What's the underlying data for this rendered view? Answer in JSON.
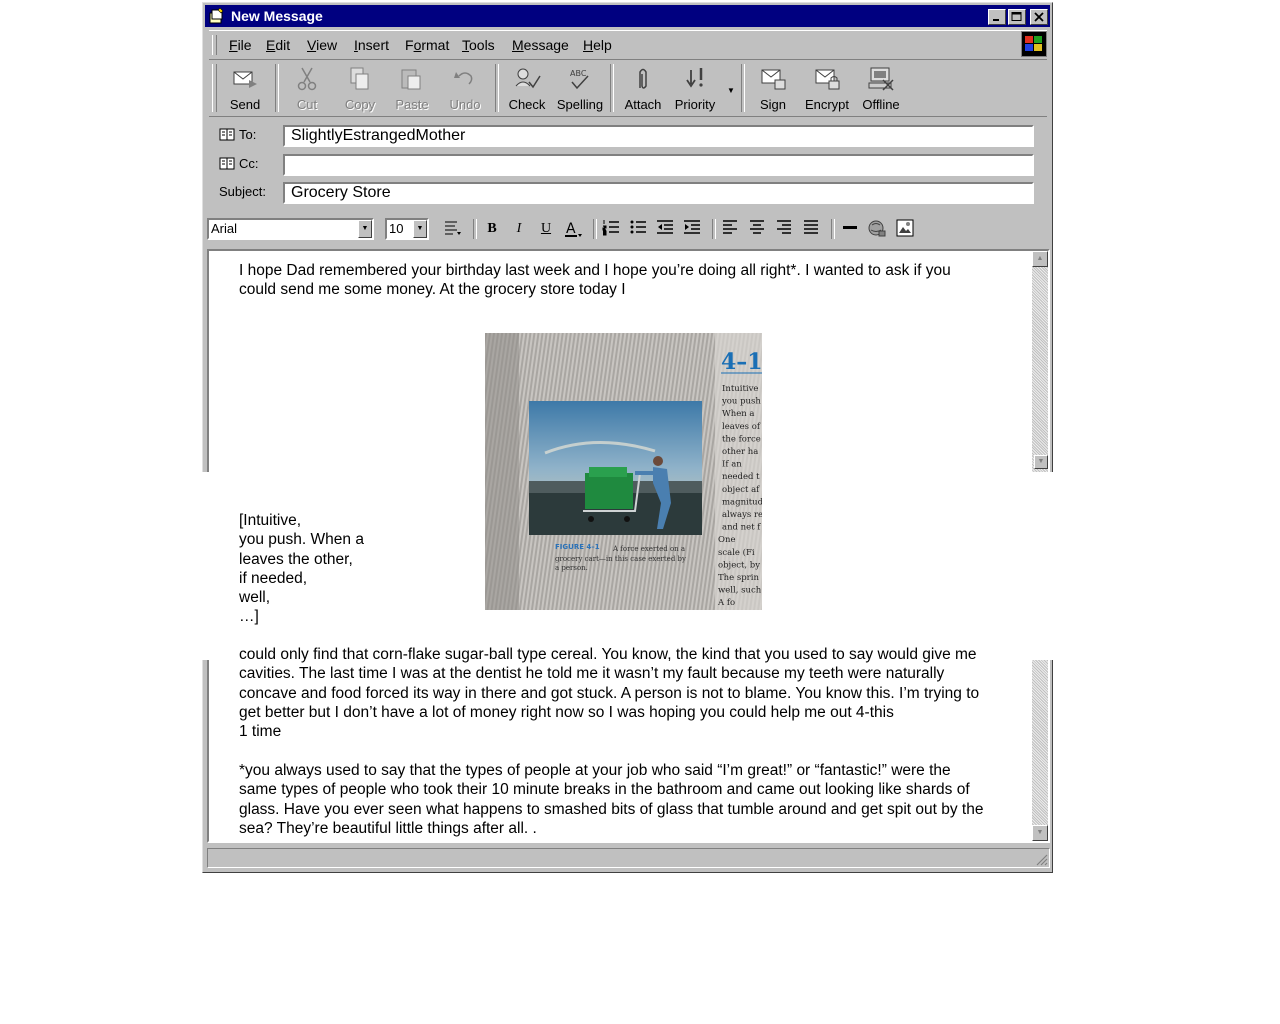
{
  "window": {
    "title": "New Message"
  },
  "menu": {
    "items": [
      {
        "label": "File",
        "u": "F",
        "rest": "ile"
      },
      {
        "label": "Edit",
        "u": "E",
        "rest": "dit"
      },
      {
        "label": "View",
        "u": "V",
        "rest": "iew"
      },
      {
        "label": "Insert",
        "u": "I",
        "rest": "nsert"
      },
      {
        "label": "Format",
        "pre": "F",
        "u": "o",
        "rest": "rmat"
      },
      {
        "label": "Tools",
        "u": "T",
        "rest": "ools"
      },
      {
        "label": "Message",
        "u": "M",
        "rest": "essage"
      },
      {
        "label": "Help",
        "u": "H",
        "rest": "elp"
      }
    ]
  },
  "toolbar": {
    "send": "Send",
    "cut": "Cut",
    "copy": "Copy",
    "paste": "Paste",
    "undo": "Undo",
    "check": "Check",
    "spelling": "Spelling",
    "attach": "Attach",
    "priority": "Priority",
    "sign": "Sign",
    "encrypt": "Encrypt",
    "offline": "Offline"
  },
  "headers": {
    "to_label": "To:",
    "to_value": "SlightlyEstrangedMother",
    "cc_label": "Cc:",
    "cc_value": "",
    "subject_label": "Subject:",
    "subject_value": "Grocery Store"
  },
  "format": {
    "font": "Arial",
    "size": "10"
  },
  "body": {
    "para1_line1": "I hope Dad remembered your birthday last week and I hope you’re doing all right*. I wanted to ask if you",
    "para1_line2": "could send me some money. At the grocery store today I",
    "excerpt": [
      "[Intuitive,",
      "you push. When a",
      "leaves the other,",
      "if needed,",
      "well,",
      "…]"
    ],
    "para2_lines": [
      "could only find that corn-flake sugar-ball type cereal. You know, the kind that you used to say would give me",
      "cavities. The last time I was at the dentist he told me it wasn’t my fault because my teeth were naturally",
      "concave and food forced its way in there and got stuck. A person is not to blame. You know this. I’m trying to",
      "get better but I don’t have a lot of money right now so I was hoping you could help me out 4-this",
      "1 time"
    ],
    "para3_lines": [
      "*you always used to say that the types of people at your job who said “I’m great!” or “fantastic!” were the",
      "same types of people who took their 10 minute breaks in the bathroom and came out looking like shards of",
      "glass. Have you ever seen what happens to smashed bits of glass that tumble around and get spit out by the",
      "sea? They’re beautiful little things after all. ."
    ]
  },
  "photo": {
    "heading": "4–1",
    "figure_label": "FIGURE 4–1",
    "caption": "A force exerted on a grocery cart—in this case exerted by a person.",
    "column_lines": [
      "Intuitive",
      "you push",
      "When a",
      "leaves of",
      "the force",
      "other ha",
      "If an",
      "needed t",
      "object af",
      "magnitud",
      "always re",
      "and net f",
      "One",
      "scale (Fi",
      "object, by",
      "The sprin",
      "well, such",
      "A fo"
    ]
  },
  "colors": {
    "titlebar": "#000080",
    "chrome": "#c0c0c0",
    "heading_blue": "#1a6fb5"
  }
}
